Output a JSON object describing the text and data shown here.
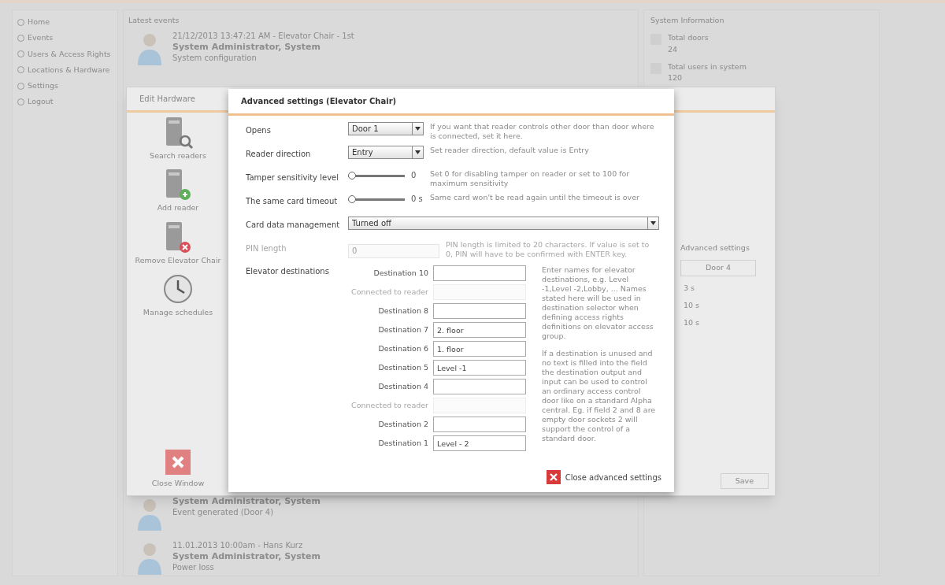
{
  "nav": [
    {
      "label": "Home"
    },
    {
      "label": "Events"
    },
    {
      "label": "Users & Access Rights"
    },
    {
      "label": "Locations & Hardware"
    },
    {
      "label": "Settings"
    },
    {
      "label": "Logout"
    }
  ],
  "latest_events": {
    "title": "Latest events",
    "events": [
      {
        "meta": "21/12/2013 13:47:21 AM - Elevator Chair - 1st",
        "user": "System Administrator, System",
        "text": "System configuration"
      },
      {
        "user": "System Administrator, System",
        "text": "Event generated (Door 4)"
      },
      {
        "meta": "11.01.2013 10:00am - Hans Kurz",
        "user": "System Administrator, System",
        "text": "Power loss"
      }
    ]
  },
  "system_info": {
    "title": "System Information",
    "stats": [
      {
        "label": "Total doors",
        "value": "24"
      },
      {
        "label": "Total users in system",
        "value": "120"
      }
    ]
  },
  "edit_window": {
    "title": "Edit Hardware",
    "tools": [
      {
        "kind": "search",
        "label": "Search readers"
      },
      {
        "kind": "add",
        "label": "Add reader"
      },
      {
        "kind": "remove",
        "label": "Remove Elevator Chair"
      },
      {
        "kind": "schedule",
        "label": "Manage schedules"
      }
    ],
    "close": "Close Window",
    "advanced_button": "Advanced settings",
    "door_tab": "Door 4",
    "times": [
      "3 s",
      "10 s",
      "10 s"
    ],
    "save": "Save"
  },
  "modal": {
    "title": "Advanced settings (Elevator Chair)",
    "rows": [
      {
        "kind": "select",
        "label": "Opens",
        "value": "Door 1",
        "help": "If you want that reader controls other door than door where is connected, set it here."
      },
      {
        "kind": "select",
        "label": "Reader direction",
        "value": "Entry",
        "help": "Set reader direction, default value is Entry"
      },
      {
        "kind": "slider",
        "label": "Tamper sensitivity level",
        "level": 0,
        "reading": "0",
        "help": "Set 0 for disabling tamper on reader or set to 100 for maximum sensitivity"
      },
      {
        "kind": "slider",
        "label": "The same card timeout",
        "level": 0,
        "reading": "0 s",
        "help": "Same card won't be read again until the timeout is over"
      },
      {
        "kind": "wide_select",
        "label": "Card data management",
        "value": "Turned off"
      },
      {
        "kind": "input",
        "label": "PIN length",
        "value": "0",
        "disabled": true,
        "help": "PIN length is limited to 20 characters. If value is set to 0, PIN will have to be confirmed with ENTER key."
      }
    ],
    "destinations_label": "Elevator destinations",
    "destinations": [
      {
        "label": "Destination 10",
        "disabled": false
      },
      {
        "label": "Connected to reader",
        "disabled": true
      },
      {
        "label": "Destination 8",
        "disabled": false
      },
      {
        "label": "Destination 7",
        "value": "2. floor",
        "disabled": false
      },
      {
        "label": "Destination 6",
        "value": "1. floor",
        "disabled": false
      },
      {
        "label": "Destination 5",
        "value": "Level -1",
        "disabled": false
      },
      {
        "label": "Destination 4",
        "disabled": false
      },
      {
        "label": "Connected to reader",
        "disabled": true
      },
      {
        "label": "Destination 2",
        "disabled": false
      },
      {
        "label": "Destination 1",
        "value": "Level - 2",
        "disabled": false
      }
    ],
    "destinations_help": [
      "Enter names for elevator destinations, e.g. Level -1,Level -2,Lobby, ... Names stated here will be used in destination selector when defining access rights definitions on elevator access group.",
      "If a destination is unused and no text is filled into the field the destination output and input can be used to control an ordinary access control door like on a standard Alpha central. Eg. if field 2 and 8 are empty door sockets 2 will support the control of a standard door."
    ],
    "close": "Close advanced settings"
  }
}
